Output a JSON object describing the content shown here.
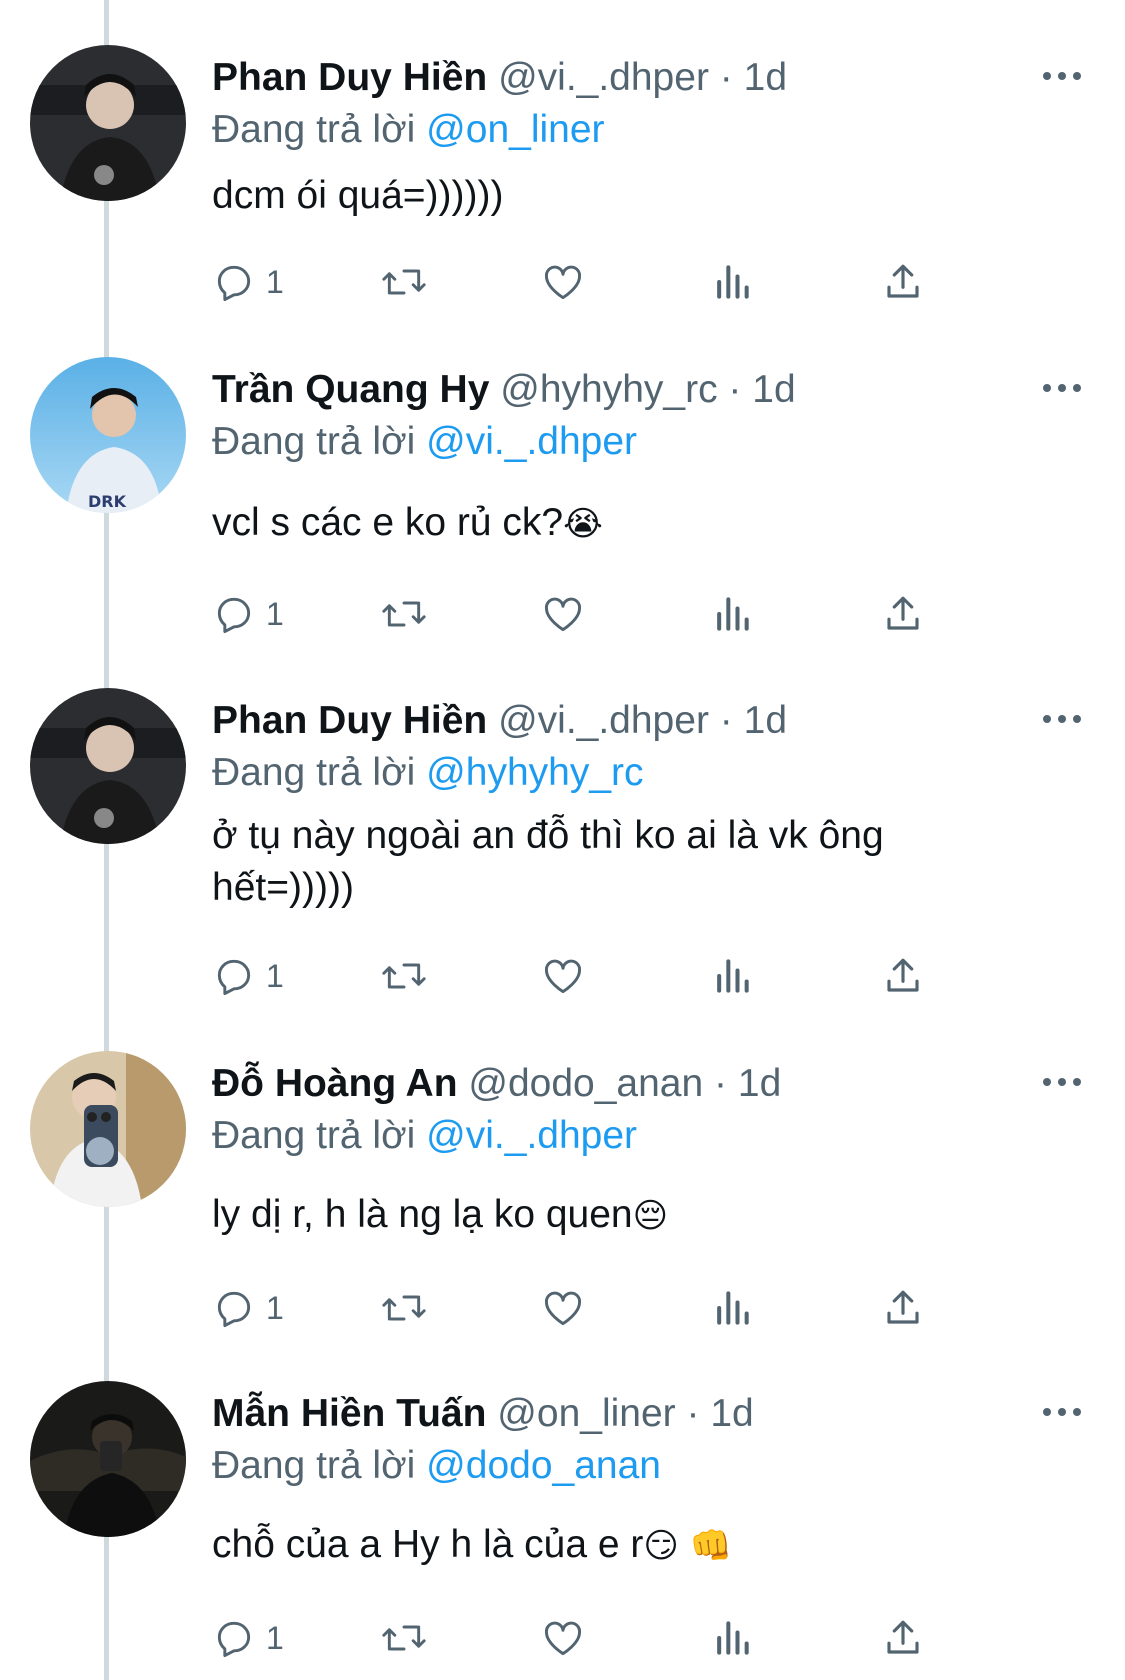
{
  "labels": {
    "replying_prefix": "Đang trả lời "
  },
  "colors": {
    "link": "#1d9bf0",
    "meta": "#536471",
    "thread_line": "#cfd9de"
  },
  "icons": [
    "reply-icon",
    "retweet-icon",
    "like-icon",
    "views-icon",
    "share-icon",
    "more-icon"
  ],
  "tweets": [
    {
      "name": "Phan Duy Hiền",
      "handle": "@vi._.dhper",
      "sep": "·",
      "time": "1d",
      "replying_to": "@on_liner",
      "text": "dcm ói quá=))))))",
      "reply_count": "1"
    },
    {
      "name": "Trần Quang Hy",
      "handle": "@hyhyhy_rc",
      "sep": "·",
      "time": "1d",
      "replying_to": "@vi._.dhper",
      "text": "vcl s các e ko rủ ck?",
      "emoji": "😭",
      "reply_count": "1"
    },
    {
      "name": "Phan Duy Hiền",
      "handle": "@vi._.dhper",
      "sep": "·",
      "time": "1d",
      "replying_to": "@hyhyhy_rc",
      "text_line1": "ở tụ này ngoài an đỗ thì ko ai là vk ông",
      "text_line2": "hết=)))))",
      "reply_count": "1"
    },
    {
      "name": "Đỗ Hoàng An",
      "handle": "@dodo_anan",
      "sep": "·",
      "time": "1d",
      "replying_to": "@vi._.dhper",
      "text": "ly dị r, h là ng lạ ko quen",
      "emoji": "😔",
      "reply_count": "1"
    },
    {
      "name": "Mẫn Hiền Tuấn",
      "handle": "@on_liner",
      "sep": "·",
      "time": "1d",
      "replying_to": "@dodo_anan",
      "text": "chỗ của a Hy h là của e r",
      "emoji": "😏 👊",
      "reply_count": "1"
    }
  ]
}
